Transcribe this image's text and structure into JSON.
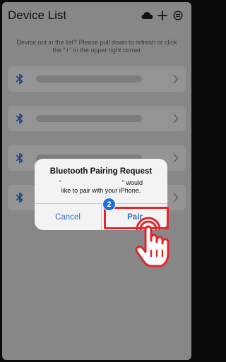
{
  "header": {
    "title": "Device List"
  },
  "notice": "Device not in the list? Please pull down to refresh or click the \"+\" in the upper right corner",
  "devices": [
    {
      "icon": "bluetooth-icon"
    },
    {
      "icon": "bluetooth-icon"
    },
    {
      "icon": "bluetooth-icon"
    },
    {
      "icon": "bluetooth-icon"
    }
  ],
  "dialog": {
    "title": "Bluetooth Pairing Request",
    "message_open_quote": "“",
    "message_close_quote": "” would",
    "message_line2": "like to pair with your iPhone.",
    "cancel_label": "Cancel",
    "pair_label": "Pair"
  },
  "annotation": {
    "step_number": "2"
  },
  "colors": {
    "accent": "#2f6fd0",
    "bluetooth": "#2f6fd0",
    "highlight": "#e0262b",
    "badge": "#1c6fe0"
  }
}
